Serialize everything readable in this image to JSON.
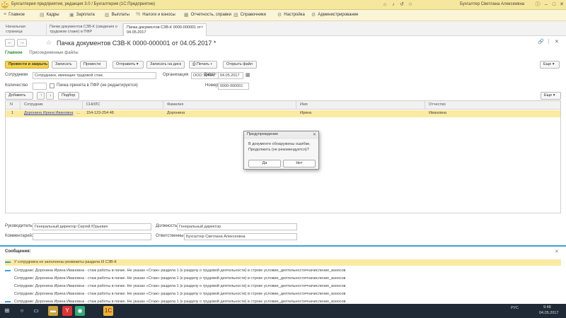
{
  "window": {
    "title": "Бухгалтерия предприятия, редакция 3.0 / Бухгалтерия (1С:Предприятие)",
    "user": "Бухгалтер Светлана Алексеевна",
    "logo_letter": "1С"
  },
  "menu": [
    {
      "icon": "hamburger-icon",
      "label": "Главное"
    },
    {
      "icon": "doc-icon",
      "label": "Кадры"
    },
    {
      "icon": "wallet-icon",
      "label": "Зарплата"
    },
    {
      "icon": "bank-icon",
      "label": "Выплаты"
    },
    {
      "icon": "tax-icon",
      "label": "Налоги и взносы"
    },
    {
      "icon": "report-icon",
      "label": "Отчетность, справки"
    },
    {
      "icon": "book-icon",
      "label": "Справочники"
    },
    {
      "icon": "gear-icon",
      "label": "Настройка"
    },
    {
      "icon": "admin-icon",
      "label": "Администрирование"
    }
  ],
  "tabs": [
    {
      "label": "Начальная страница"
    },
    {
      "label": "Пачки документов СЗВ-К (сведения о трудовом стаже) в ПФР"
    },
    {
      "label": "Пачка документов СЗВ-К 0000-000001 от 04.05.2017"
    }
  ],
  "document": {
    "title": "Пачка документов СЗВ-К 0000-000001 от 04.05.2017 *",
    "nav_main": "Главное",
    "nav_secondary": "Присоединенные файлы"
  },
  "toolbar": {
    "post_close": "Провести и закрыть",
    "write": "Записать",
    "post": "Провести",
    "send": "Отправить",
    "write_file": "Записать на диск",
    "print": "Печать",
    "open_file": "Открыть файл",
    "more": "Еще"
  },
  "form": {
    "employees_label": "Сотрудники",
    "employees_value": "Сотрудники, имеющие трудовой стаж",
    "org_label": "Организация",
    "org_value": "ООО \"ОКЕЙ\"",
    "date_label": "Дата",
    "date_value": "04.05.2017",
    "period_label": "Количество",
    "period_value": "",
    "check_label": "Пачка принята в ПФР (не редактируется)",
    "number_label": "Номер",
    "number_value": "0000-000001"
  },
  "grid_toolbar": {
    "add": "Добавить",
    "fill": "Подбор",
    "more": "Еще"
  },
  "grid": {
    "columns": [
      "N",
      "Сотрудник",
      "СНИЛС",
      "Фамилия",
      "Имя",
      "Отчество"
    ],
    "rows": [
      {
        "n": "1",
        "employee": "Доронина Ирина Ивановна",
        "snils": "154-123-254 48",
        "surname": "Доронина",
        "name": "Ирина",
        "patronymic": "Ивановна"
      }
    ]
  },
  "dialog": {
    "title": "Предупреждение",
    "message": "В документе обнаружены ошибки. Продолжить (не рекомендуется)?",
    "yes": "Да",
    "no": "Нет"
  },
  "bottom": {
    "head_label": "Руководитель:",
    "head_value": "Генеральный директор Сергей Юрьевич",
    "position_label": "Должность:",
    "position_value": "Генеральный директор",
    "comment_label": "Комментарий:",
    "comment_value": "",
    "responsible_label": "Ответственный:",
    "responsible_value": "Бухгалтер Светлана Алексеевна"
  },
  "messages": {
    "title": "Сообщения:",
    "items": [
      {
        "text": "У сотрудника не заполнены реквизиты раздела III СЗВ-К",
        "highlight": true
      },
      {
        "text": "Сотрудник: Доронина Ирина Ивановна - стаж работы в пачке. Не указан «Стаж» раздела 1 (к разделу о трудовой деятельности) в строке условие_деятельности=начисление_взносов",
        "highlight": false
      },
      {
        "text": "Сотрудник: Доронина Ирина Ивановна - стаж работы в пачке. Не указан «Стаж» раздела 1 (к разделу о трудовой деятельности) в строке условие_деятельности=начисление_взносов",
        "highlight": false
      },
      {
        "text": "Сотрудник: Доронина Ирина Ивановна - стаж работы в пачке. Не указан «Стаж» раздела 1 (к разделу о трудовой деятельности) в строке условие_деятельности=начисление_взносов",
        "highlight": false
      },
      {
        "text": "Сотрудник: Доронина Ирина Ивановна - стаж работы в пачке. Не указан «Стаж» раздела 1 (к разделу о трудовой деятельности) в строке условие_деятельности=начисление_взносов",
        "highlight": false
      },
      {
        "text": "Сотрудник: Доронина Ирина Ивановна - стаж работы в пачке. Не указан «Стаж» раздела 1 (к разделу о трудовой деятельности) в строке условие_деятельности=начисление_взносов",
        "highlight": false
      }
    ]
  },
  "taskbar": {
    "apps": [
      "start-icon",
      "search-icon",
      "task-view-icon",
      "explorer-icon",
      "yandex-icon",
      "chrome-icon",
      "1c-icon"
    ],
    "lang": "РУС",
    "time": "9:48",
    "date": "04.05.2017"
  }
}
